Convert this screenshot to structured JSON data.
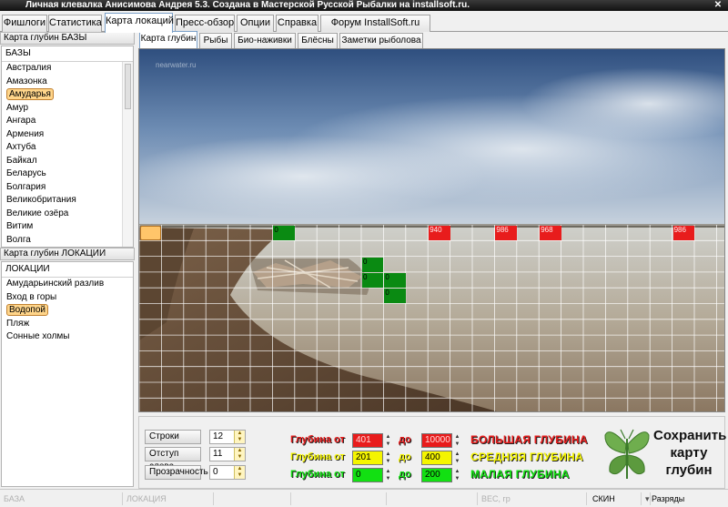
{
  "window": {
    "title": "Личная клевалка Анисимова Андрея 5.3. Создана в Мастерской Русской Рыбалки на installsoft.ru."
  },
  "top_tabs": [
    "Фишлоги",
    "Статистика",
    "Карта локаций",
    "Пресс-обзор",
    "Опции",
    "Справка",
    "Форум InstallSoft.ru"
  ],
  "active_top_tab": "Карта локаций",
  "bases_panel": {
    "header": "Карта глубин БАЗЫ",
    "column": "БАЗЫ",
    "items": [
      "Австралия",
      "Амазонка",
      "Амударья",
      "Амур",
      "Ангара",
      "Армения",
      "Ахтуба",
      "Байкал",
      "Беларусь",
      "Болгария",
      "Великобритания",
      "Великие озёра",
      "Витим",
      "Волга"
    ],
    "selected": "Амударья"
  },
  "locations_panel": {
    "header": "Карта глубин ЛОКАЦИИ",
    "column": "ЛОКАЦИИ",
    "items": [
      "Амударьинский разлив",
      "Вход в горы",
      "Водопой",
      "Пляж",
      "Сонные холмы"
    ],
    "selected": "Водопой"
  },
  "sub_tabs": [
    "Карта глубин",
    "Рыбы",
    "Био-наживки",
    "Блёсны",
    "Заметки рыболова"
  ],
  "active_sub_tab": "Карта глубин",
  "photo": {
    "watermark": "nearwater.ru"
  },
  "depth_grid": {
    "rows": 12,
    "cols": 26,
    "marks": [
      {
        "row": 0,
        "col": 0,
        "value": "",
        "kind": "selected"
      },
      {
        "row": 0,
        "col": 6,
        "value": "0",
        "kind": "green"
      },
      {
        "row": 0,
        "col": 13,
        "value": "940",
        "kind": "red"
      },
      {
        "row": 0,
        "col": 16,
        "value": "986",
        "kind": "red"
      },
      {
        "row": 0,
        "col": 18,
        "value": "968",
        "kind": "red"
      },
      {
        "row": 0,
        "col": 24,
        "value": "986",
        "kind": "red"
      },
      {
        "row": 2,
        "col": 10,
        "value": "0",
        "kind": "green"
      },
      {
        "row": 3,
        "col": 10,
        "value": "0",
        "kind": "green"
      },
      {
        "row": 3,
        "col": 11,
        "value": "0",
        "kind": "green"
      },
      {
        "row": 4,
        "col": 11,
        "value": "0",
        "kind": "green"
      }
    ]
  },
  "grid_settings": {
    "rows_label": "Строки",
    "rows_value": "12",
    "offset_label": "Отступ слева",
    "offset_value": "11",
    "opacity_label": "Прозрачность",
    "opacity_value": "0"
  },
  "depth_ranges": [
    {
      "label": "Глубина от",
      "from": "401",
      "to_label": "до",
      "to": "10000",
      "name": "БОЛЬШАЯ ГЛУБИНА",
      "color": "#e81c1c"
    },
    {
      "label": "Глубина от",
      "from": "201",
      "to_label": "до",
      "to": "400",
      "name": "СРЕДНЯЯ ГЛУБИНА",
      "color": "#f5f500"
    },
    {
      "label": "Глубина от",
      "from": "0",
      "to_label": "до",
      "to": "200",
      "name": "МАЛАЯ ГЛУБИНА",
      "color": "#12e012"
    }
  ],
  "save_button": {
    "label": "Сохранить карту глубин",
    "icon": "butterfly-icon"
  },
  "status_bar": {
    "base": "БАЗА",
    "location": "ЛОКАЦИЯ",
    "weight": "ВЕС, гр",
    "skin": "СКИН",
    "digits": "Разряды"
  }
}
